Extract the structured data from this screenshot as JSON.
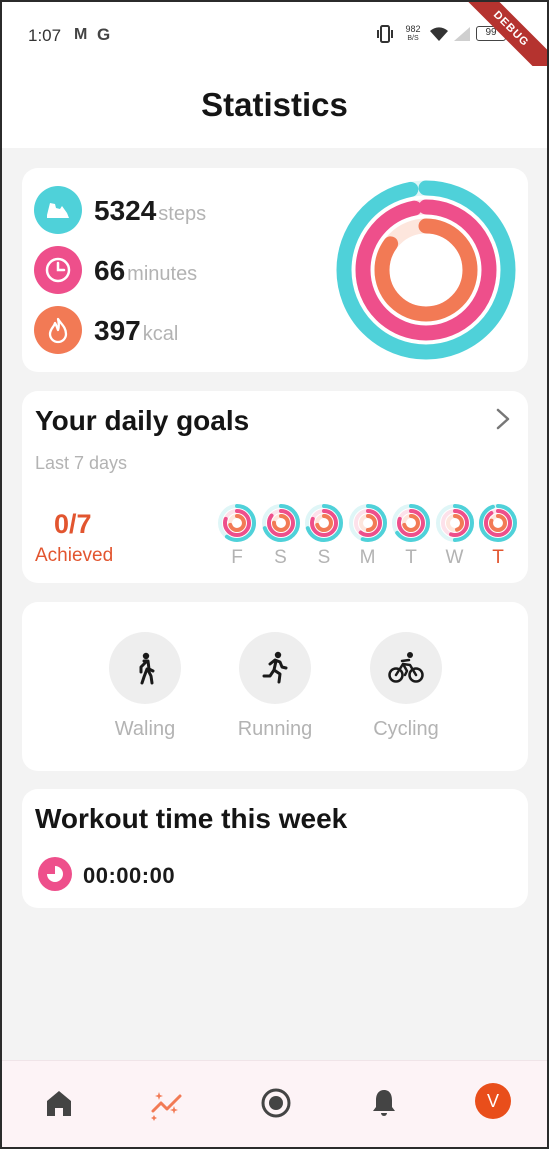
{
  "status_bar": {
    "time": "1:07",
    "notif_m": "M",
    "notif_g": "G",
    "net_speed_value": "982",
    "net_speed_unit": "B/S",
    "battery": "99",
    "debug_banner": "DEBUG"
  },
  "header": {
    "title": "Statistics"
  },
  "summary": {
    "stats": [
      {
        "icon": "shoe-icon",
        "value": "5324",
        "unit": "steps",
        "color": "#4fd1d9"
      },
      {
        "icon": "clock-icon",
        "value": "66",
        "unit": "minutes",
        "color": "#ee4f8b"
      },
      {
        "icon": "flame-icon",
        "value": "397",
        "unit": "kcal",
        "color": "#f27a55"
      }
    ],
    "rings_progress": {
      "steps": 0.97,
      "minutes": 0.97,
      "kcal": 0.85
    }
  },
  "goals": {
    "title": "Your daily goals",
    "subtitle": "Last 7 days",
    "achieved_count": "0/7",
    "achieved_label": "Achieved",
    "days": [
      {
        "label": "F",
        "today": false,
        "progress": [
          0.6,
          0.8,
          0.7
        ]
      },
      {
        "label": "S",
        "today": false,
        "progress": [
          0.7,
          0.85,
          0.75
        ]
      },
      {
        "label": "S",
        "today": false,
        "progress": [
          0.7,
          0.8,
          0.7
        ]
      },
      {
        "label": "M",
        "today": false,
        "progress": [
          0.55,
          0.6,
          0.5
        ]
      },
      {
        "label": "T",
        "today": false,
        "progress": [
          0.65,
          0.8,
          0.7
        ]
      },
      {
        "label": "W",
        "today": false,
        "progress": [
          0.5,
          0.55,
          0.45
        ]
      },
      {
        "label": "T",
        "today": true,
        "progress": [
          0.95,
          0.9,
          0.8
        ]
      }
    ]
  },
  "activities": [
    {
      "icon": "walking-icon",
      "label": "Waling"
    },
    {
      "icon": "running-icon",
      "label": "Running"
    },
    {
      "icon": "cycling-icon",
      "label": "Cycling"
    }
  ],
  "workout": {
    "title": "Workout time this week",
    "time": "00:00:00"
  },
  "nav": {
    "items": [
      "home-icon",
      "statistics-icon",
      "record-icon",
      "bell-icon"
    ],
    "avatar_initial": "V",
    "active_color": "#f27a55"
  },
  "colors": {
    "teal": "#4fd1d9",
    "pink": "#ee4f8b",
    "orange": "#f27a55",
    "accent_text": "#e2552f"
  }
}
